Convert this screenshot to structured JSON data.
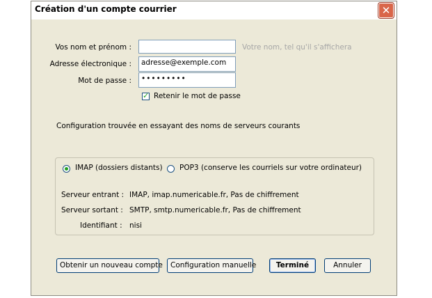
{
  "window": {
    "title": "Création d'un compte courrier",
    "close_glyph": "✕"
  },
  "form": {
    "name_label": "Vos nom et prénom :",
    "name_value": "",
    "name_hint": "Votre nom, tel qu'il s'affichera",
    "email_label": "Adresse électronique :",
    "email_value": "adresse@exemple.com",
    "password_label": "Mot de passe :",
    "password_value": "•••••••••",
    "remember_label": "Retenir le mot de passe",
    "remember_checked": true
  },
  "status_text": "Configuration trouvée en essayant des noms de serveurs courants",
  "config": {
    "imap_label": "IMAP (dossiers distants)",
    "pop3_label": "POP3 (conserve les courriels sur votre ordinateur)",
    "selected": "imap",
    "incoming_label": "Serveur entrant :",
    "incoming_value": "IMAP, imap.numericable.fr, Pas de chiffrement",
    "outgoing_label": "Serveur sortant :",
    "outgoing_value": "SMTP, smtp.numericable.fr, Pas de chiffrement",
    "identifier_label": "Identifiant :",
    "identifier_value": "nisi"
  },
  "buttons": {
    "new_account": "Obtenir un nouveau compte",
    "manual_config": "Configuration manuelle",
    "done": "Terminé",
    "cancel": "Annuler"
  }
}
